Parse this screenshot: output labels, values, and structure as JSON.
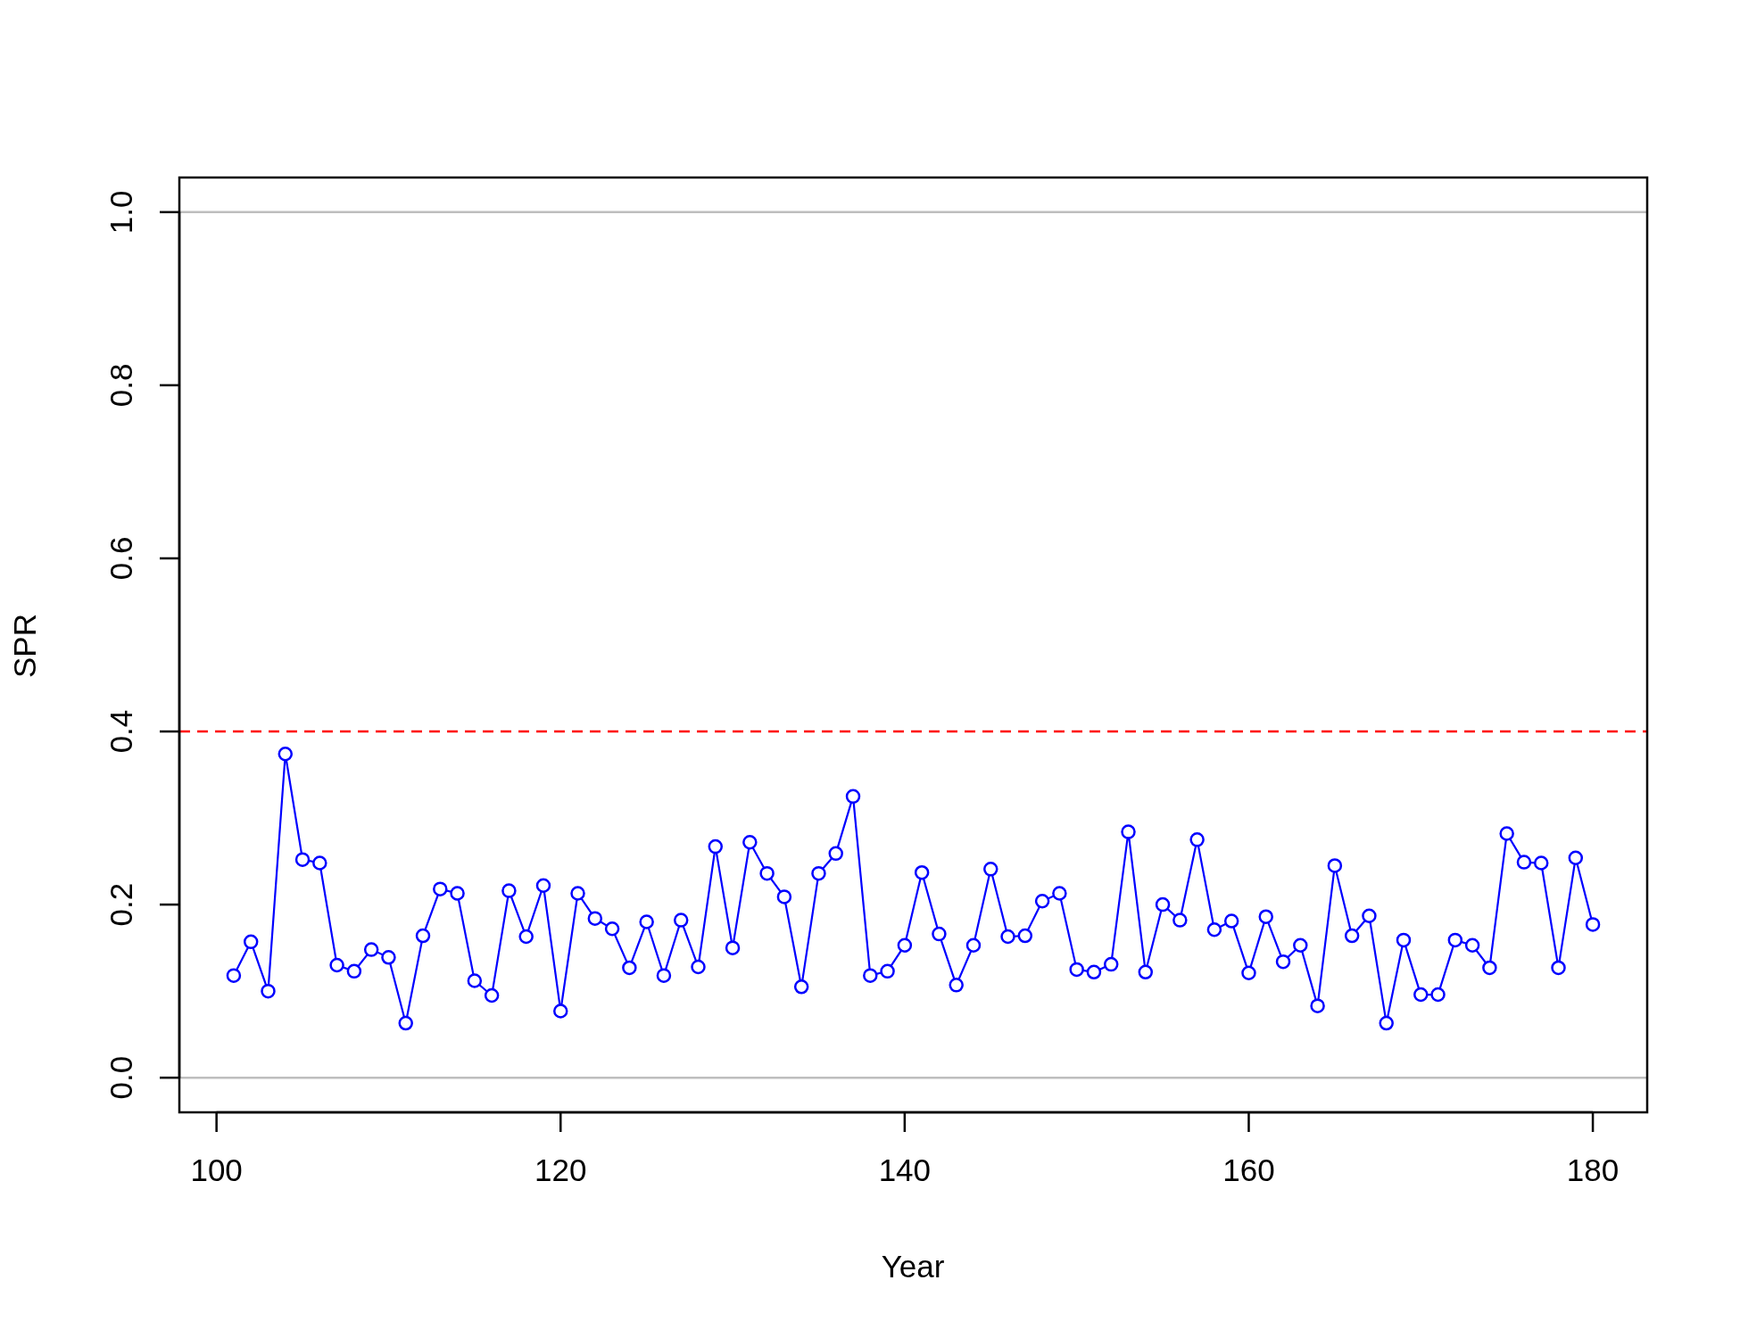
{
  "chart_data": {
    "type": "line",
    "xlabel": "Year",
    "ylabel": "SPR",
    "xlim": [
      97.84,
      183.16
    ],
    "ylim": [
      -0.04,
      1.04
    ],
    "xticks": [
      100,
      120,
      140,
      160,
      180
    ],
    "yticks": [
      {
        "value": 0,
        "label": "0.0"
      },
      {
        "value": 0.2,
        "label": "0.2"
      },
      {
        "value": 0.4,
        "label": "0.4"
      },
      {
        "value": 0.6,
        "label": "0.6"
      },
      {
        "value": 0.8,
        "label": "0.8"
      },
      {
        "value": 1,
        "label": "1.0"
      }
    ],
    "x": [
      101,
      102,
      103,
      104,
      105,
      106,
      107,
      108,
      109,
      110,
      111,
      112,
      113,
      114,
      115,
      116,
      117,
      118,
      119,
      120,
      121,
      122,
      123,
      124,
      125,
      126,
      127,
      128,
      129,
      130,
      131,
      132,
      133,
      134,
      135,
      136,
      137,
      138,
      139,
      140,
      141,
      142,
      143,
      144,
      145,
      146,
      147,
      148,
      149,
      150,
      151,
      152,
      153,
      154,
      155,
      156,
      157,
      158,
      159,
      160,
      161,
      162,
      163,
      164,
      165,
      166,
      167,
      168,
      169,
      170,
      171,
      172,
      173,
      174,
      175,
      176,
      177,
      178,
      179,
      180
    ],
    "series": [
      {
        "color": "#0000ff",
        "marker": "circle",
        "values": [
          0.118,
          0.157,
          0.1,
          0.374,
          0.252,
          0.248,
          0.13,
          0.123,
          0.148,
          0.139,
          0.063,
          0.164,
          0.218,
          0.213,
          0.112,
          0.095,
          0.216,
          0.163,
          0.222,
          0.077,
          0.213,
          0.184,
          0.172,
          0.127,
          0.18,
          0.118,
          0.182,
          0.128,
          0.267,
          0.15,
          0.272,
          0.236,
          0.209,
          0.105,
          0.236,
          0.259,
          0.325,
          0.118,
          0.123,
          0.153,
          0.237,
          0.166,
          0.107,
          0.153,
          0.241,
          0.163,
          0.164,
          0.204,
          0.213,
          0.125,
          0.122,
          0.131,
          0.284,
          0.122,
          0.2,
          0.182,
          0.275,
          0.171,
          0.181,
          0.121,
          0.186,
          0.134,
          0.153,
          0.083,
          0.245,
          0.164,
          0.187,
          0.063,
          0.159,
          0.096,
          0.096,
          0.159,
          0.153,
          0.127,
          0.282,
          0.249,
          0.248,
          0.127,
          0.254,
          0.177
        ]
      }
    ],
    "ref_lines": [
      {
        "axis": "y",
        "value": 0,
        "color": "#bebebe"
      },
      {
        "axis": "y",
        "value": 1,
        "color": "#bebebe"
      },
      {
        "axis": "y",
        "value": 0.4,
        "color": "#ff0000"
      }
    ]
  }
}
